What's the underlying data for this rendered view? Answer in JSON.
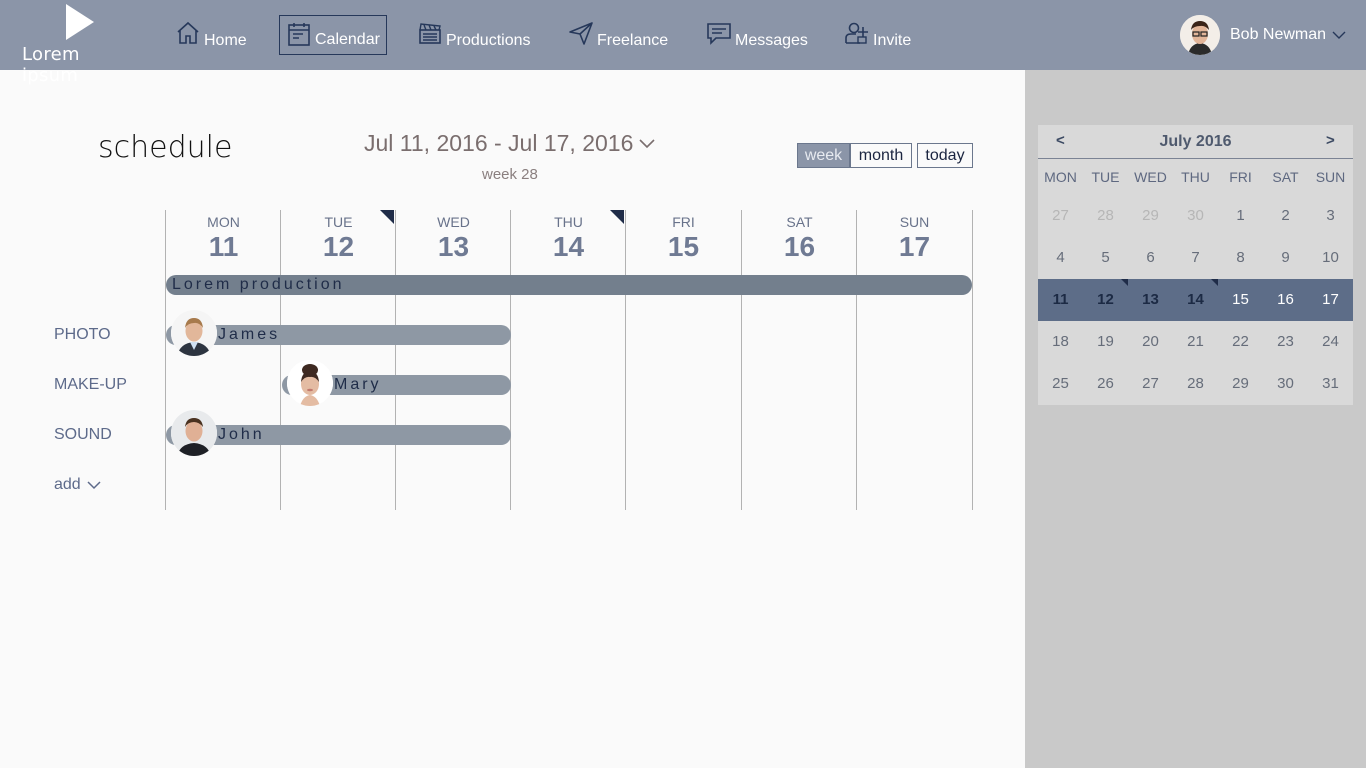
{
  "header": {
    "logo_text": "Lorem ipsum",
    "nav": [
      {
        "label": "Home",
        "icon": "home-icon"
      },
      {
        "label": "Calendar",
        "icon": "calendar-icon",
        "active": true
      },
      {
        "label": "Productions",
        "icon": "clapperboard-icon"
      },
      {
        "label": "Freelance",
        "icon": "paper-plane-icon"
      },
      {
        "label": "Messages",
        "icon": "chat-icon"
      },
      {
        "label": "Invite",
        "icon": "add-user-icon"
      }
    ],
    "user_name": "Bob Newman"
  },
  "schedule": {
    "title": "schedule",
    "range": "Jul 11, 2016 - Jul 17, 2016",
    "week": "week 28",
    "views": [
      "week",
      "month",
      "today"
    ],
    "active_view": "week",
    "days": [
      {
        "name": "MON",
        "num": "11"
      },
      {
        "name": "TUE",
        "num": "12",
        "flag": true
      },
      {
        "name": "WED",
        "num": "13"
      },
      {
        "name": "THU",
        "num": "14",
        "flag": true
      },
      {
        "name": "FRI",
        "num": "15"
      },
      {
        "name": "SAT",
        "num": "16"
      },
      {
        "name": "SUN",
        "num": "17"
      }
    ],
    "production": "Lorem production",
    "roles": [
      {
        "role": "PHOTO",
        "person": "James"
      },
      {
        "role": "MAKE-UP",
        "person": "Mary"
      },
      {
        "role": "SOUND",
        "person": "John"
      }
    ],
    "add_label": "add"
  },
  "mini_calendar": {
    "prev": "<",
    "next": ">",
    "title": "July 2016",
    "dow": [
      "MON",
      "TUE",
      "WED",
      "THU",
      "FRI",
      "SAT",
      "SUN"
    ],
    "weeks": [
      [
        "27",
        "28",
        "29",
        "30",
        "1",
        "2",
        "3"
      ],
      [
        "4",
        "5",
        "6",
        "7",
        "8",
        "9",
        "10"
      ],
      [
        "11",
        "12",
        "13",
        "14",
        "15",
        "16",
        "17"
      ],
      [
        "18",
        "19",
        "20",
        "21",
        "22",
        "23",
        "24"
      ],
      [
        "25",
        "26",
        "27",
        "28",
        "29",
        "30",
        "31"
      ]
    ]
  }
}
